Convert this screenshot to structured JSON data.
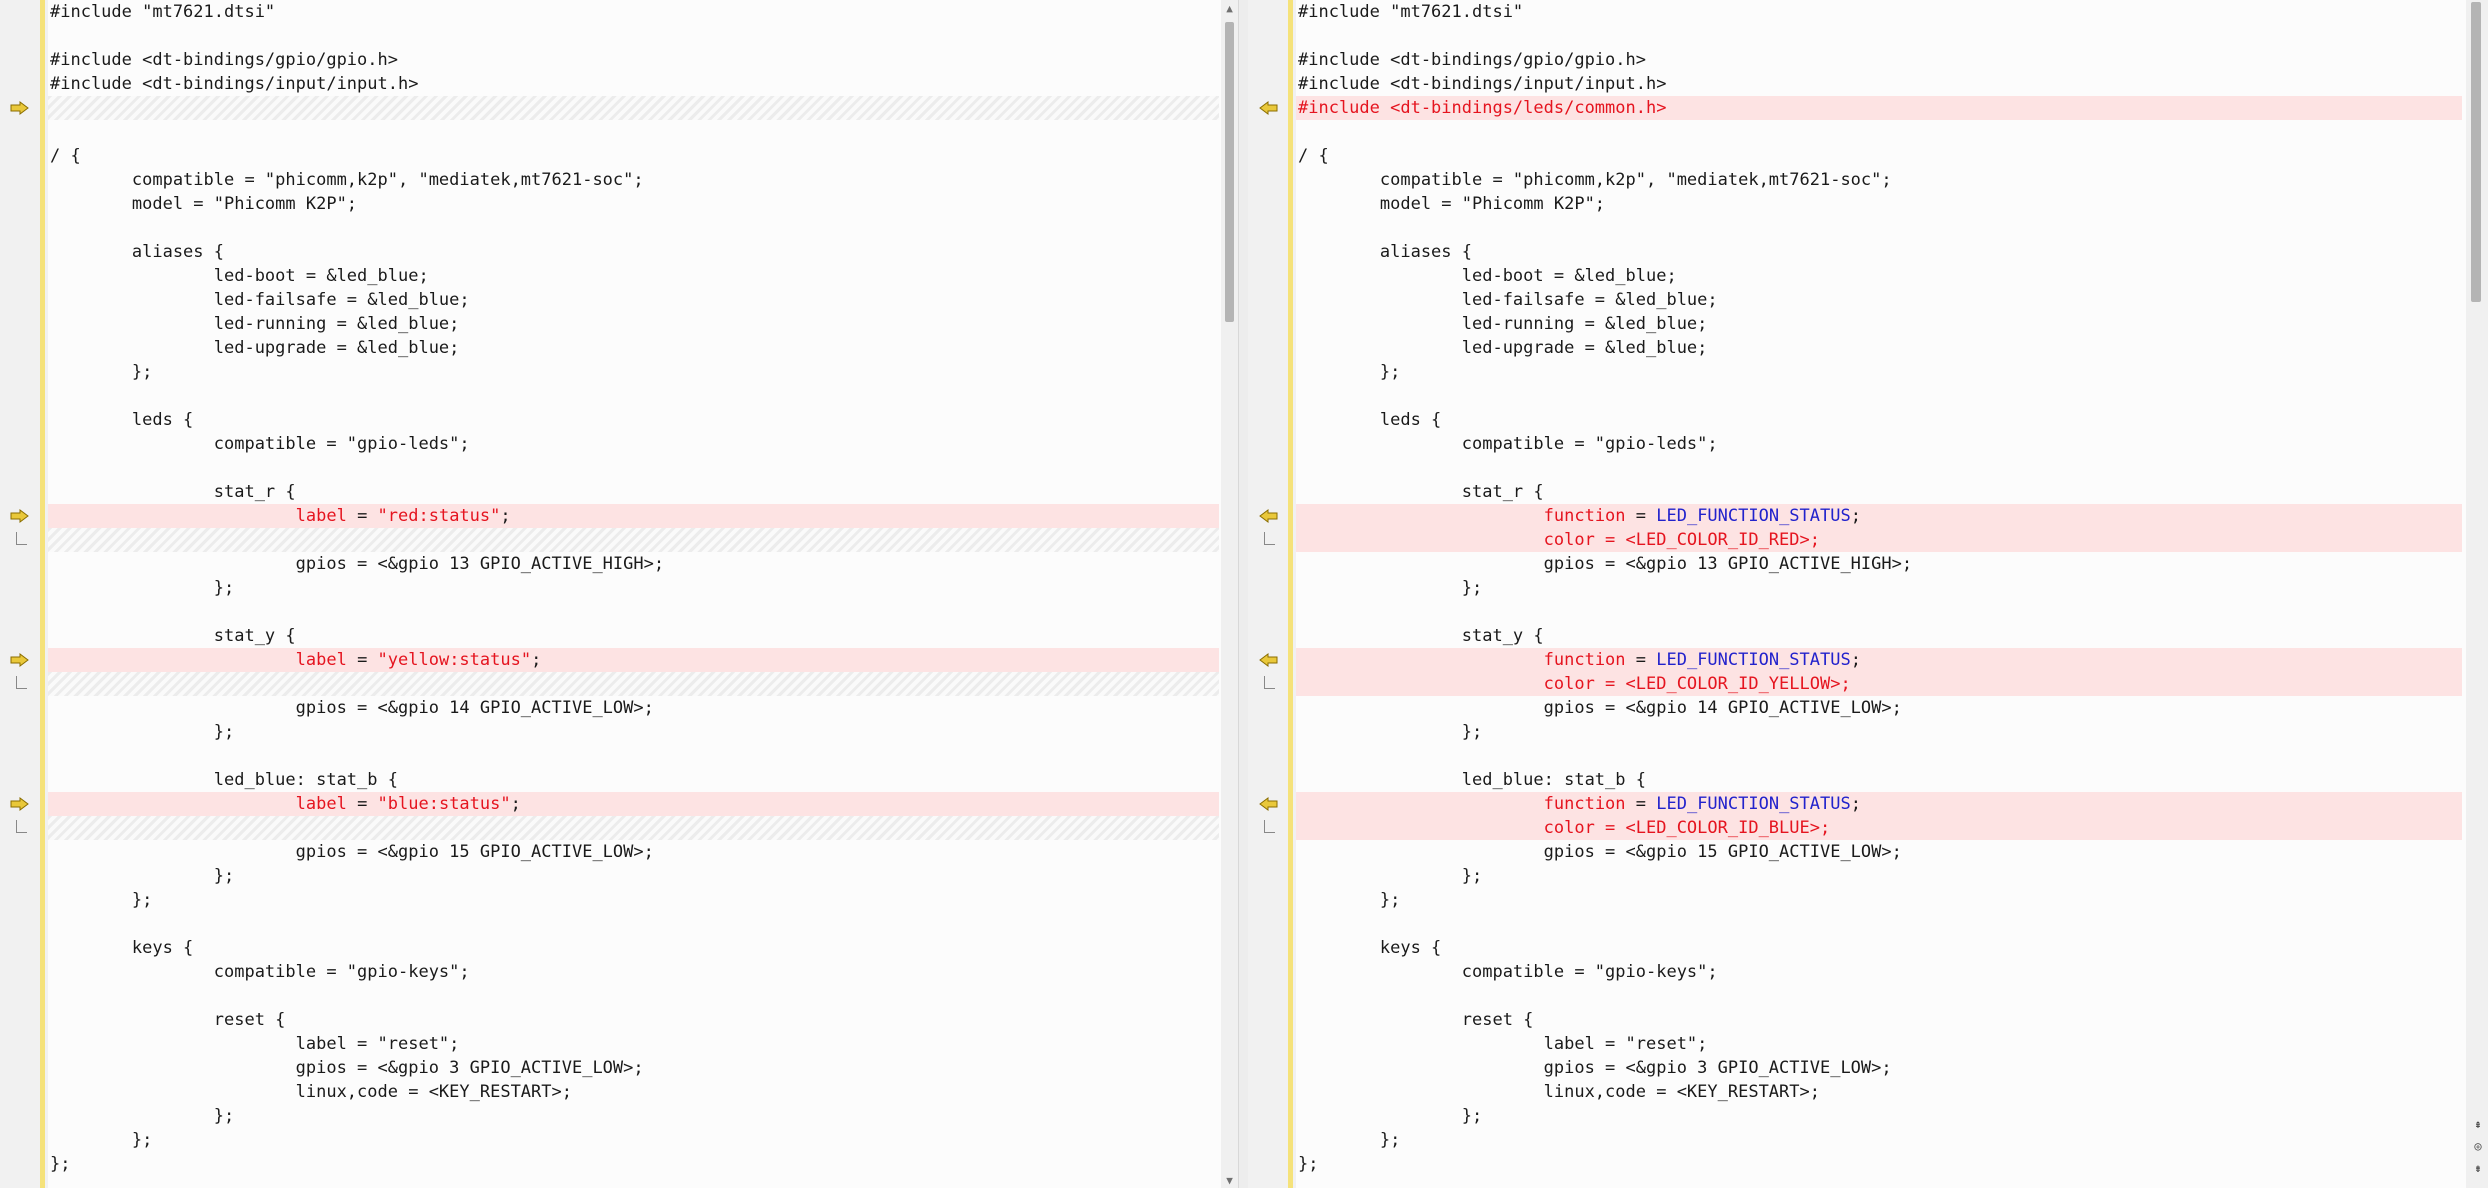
{
  "colors": {
    "diff_bg": "#fde3e3",
    "gutter_bar": "#f5e27a",
    "marker_arrow": "#e9c83a",
    "keyword_red": "#e5141f",
    "constant_blue": "#2222cc"
  },
  "icons": {
    "change_marker": "arrow-icon",
    "nav_up": "double-chevron-up-icon",
    "nav_center": "circle-icon",
    "nav_down": "double-chevron-down-icon"
  },
  "left": {
    "lines": [
      {
        "type": "normal",
        "segs": [
          {
            "t": "#include \"mt7621.dtsi\""
          }
        ]
      },
      {
        "type": "normal",
        "segs": [
          {
            "t": ""
          }
        ]
      },
      {
        "type": "normal",
        "segs": [
          {
            "t": "#include <dt-bindings/gpio/gpio.h>"
          }
        ]
      },
      {
        "type": "normal",
        "segs": [
          {
            "t": "#include <dt-bindings/input/input.h>"
          }
        ]
      },
      {
        "type": "placeholder",
        "marker": "arrow",
        "segs": [
          {
            "t": ""
          }
        ]
      },
      {
        "type": "normal",
        "segs": [
          {
            "t": ""
          }
        ]
      },
      {
        "type": "normal",
        "segs": [
          {
            "t": "/ {"
          }
        ]
      },
      {
        "type": "normal",
        "segs": [
          {
            "t": "\tcompatible = \"phicomm,k2p\", \"mediatek,mt7621-soc\";"
          }
        ]
      },
      {
        "type": "normal",
        "segs": [
          {
            "t": "\tmodel = \"Phicomm K2P\";"
          }
        ]
      },
      {
        "type": "normal",
        "segs": [
          {
            "t": ""
          }
        ]
      },
      {
        "type": "normal",
        "segs": [
          {
            "t": "\taliases {"
          }
        ]
      },
      {
        "type": "normal",
        "segs": [
          {
            "t": "\t\tled-boot = &led_blue;"
          }
        ]
      },
      {
        "type": "normal",
        "segs": [
          {
            "t": "\t\tled-failsafe = &led_blue;"
          }
        ]
      },
      {
        "type": "normal",
        "segs": [
          {
            "t": "\t\tled-running = &led_blue;"
          }
        ]
      },
      {
        "type": "normal",
        "segs": [
          {
            "t": "\t\tled-upgrade = &led_blue;"
          }
        ]
      },
      {
        "type": "normal",
        "segs": [
          {
            "t": "\t};"
          }
        ]
      },
      {
        "type": "normal",
        "segs": [
          {
            "t": ""
          }
        ]
      },
      {
        "type": "normal",
        "segs": [
          {
            "t": "\tleds {"
          }
        ]
      },
      {
        "type": "normal",
        "segs": [
          {
            "t": "\t\tcompatible = \"gpio-leds\";"
          }
        ]
      },
      {
        "type": "normal",
        "segs": [
          {
            "t": ""
          }
        ]
      },
      {
        "type": "normal",
        "segs": [
          {
            "t": "\t\tstat_r {"
          }
        ]
      },
      {
        "type": "changed",
        "marker": "arrow",
        "segs": [
          {
            "t": "\t\t\t"
          },
          {
            "t": "label",
            "c": "attr"
          },
          {
            "t": " = "
          },
          {
            "t": "\"red:status\"",
            "c": "str"
          },
          {
            "t": ";"
          }
        ]
      },
      {
        "type": "placeholder",
        "marker": "cont",
        "segs": [
          {
            "t": ""
          }
        ]
      },
      {
        "type": "normal",
        "segs": [
          {
            "t": "\t\t\tgpios = <&gpio 13 GPIO_ACTIVE_HIGH>;"
          }
        ]
      },
      {
        "type": "normal",
        "segs": [
          {
            "t": "\t\t};"
          }
        ]
      },
      {
        "type": "normal",
        "segs": [
          {
            "t": ""
          }
        ]
      },
      {
        "type": "normal",
        "segs": [
          {
            "t": "\t\tstat_y {"
          }
        ]
      },
      {
        "type": "changed",
        "marker": "arrow",
        "segs": [
          {
            "t": "\t\t\t"
          },
          {
            "t": "label",
            "c": "attr"
          },
          {
            "t": " = "
          },
          {
            "t": "\"yellow:status\"",
            "c": "str"
          },
          {
            "t": ";"
          }
        ]
      },
      {
        "type": "placeholder",
        "marker": "cont",
        "segs": [
          {
            "t": ""
          }
        ]
      },
      {
        "type": "normal",
        "segs": [
          {
            "t": "\t\t\tgpios = <&gpio 14 GPIO_ACTIVE_LOW>;"
          }
        ]
      },
      {
        "type": "normal",
        "segs": [
          {
            "t": "\t\t};"
          }
        ]
      },
      {
        "type": "normal",
        "segs": [
          {
            "t": ""
          }
        ]
      },
      {
        "type": "normal",
        "segs": [
          {
            "t": "\t\tled_blue: stat_b {"
          }
        ]
      },
      {
        "type": "changed",
        "marker": "arrow",
        "segs": [
          {
            "t": "\t\t\t"
          },
          {
            "t": "label",
            "c": "attr"
          },
          {
            "t": " = "
          },
          {
            "t": "\"blue:status\"",
            "c": "str"
          },
          {
            "t": ";"
          }
        ]
      },
      {
        "type": "placeholder",
        "marker": "cont",
        "segs": [
          {
            "t": ""
          }
        ]
      },
      {
        "type": "normal",
        "segs": [
          {
            "t": "\t\t\tgpios = <&gpio 15 GPIO_ACTIVE_LOW>;"
          }
        ]
      },
      {
        "type": "normal",
        "segs": [
          {
            "t": "\t\t};"
          }
        ]
      },
      {
        "type": "normal",
        "segs": [
          {
            "t": "\t};"
          }
        ]
      },
      {
        "type": "normal",
        "segs": [
          {
            "t": ""
          }
        ]
      },
      {
        "type": "normal",
        "segs": [
          {
            "t": "\tkeys {"
          }
        ]
      },
      {
        "type": "normal",
        "segs": [
          {
            "t": "\t\tcompatible = \"gpio-keys\";"
          }
        ]
      },
      {
        "type": "normal",
        "segs": [
          {
            "t": ""
          }
        ]
      },
      {
        "type": "normal",
        "segs": [
          {
            "t": "\t\treset {"
          }
        ]
      },
      {
        "type": "normal",
        "segs": [
          {
            "t": "\t\t\tlabel = \"reset\";"
          }
        ]
      },
      {
        "type": "normal",
        "segs": [
          {
            "t": "\t\t\tgpios = <&gpio 3 GPIO_ACTIVE_LOW>;"
          }
        ]
      },
      {
        "type": "normal",
        "segs": [
          {
            "t": "\t\t\tlinux,code = <KEY_RESTART>;"
          }
        ]
      },
      {
        "type": "normal",
        "segs": [
          {
            "t": "\t\t};"
          }
        ]
      },
      {
        "type": "normal",
        "segs": [
          {
            "t": "\t};"
          }
        ]
      },
      {
        "type": "normal",
        "segs": [
          {
            "t": "};"
          }
        ]
      }
    ]
  },
  "right": {
    "lines": [
      {
        "type": "normal",
        "segs": [
          {
            "t": "#include \"mt7621.dtsi\""
          }
        ]
      },
      {
        "type": "normal",
        "segs": [
          {
            "t": ""
          }
        ]
      },
      {
        "type": "normal",
        "segs": [
          {
            "t": "#include <dt-bindings/gpio/gpio.h>"
          }
        ]
      },
      {
        "type": "normal",
        "segs": [
          {
            "t": "#include <dt-bindings/input/input.h>"
          }
        ]
      },
      {
        "type": "changed",
        "red": true,
        "marker": "arrow",
        "segs": [
          {
            "t": "#include <dt-bindings/leds/common.h>"
          }
        ]
      },
      {
        "type": "normal",
        "segs": [
          {
            "t": ""
          }
        ]
      },
      {
        "type": "normal",
        "segs": [
          {
            "t": "/ {"
          }
        ]
      },
      {
        "type": "normal",
        "segs": [
          {
            "t": "\tcompatible = \"phicomm,k2p\", \"mediatek,mt7621-soc\";"
          }
        ]
      },
      {
        "type": "normal",
        "segs": [
          {
            "t": "\tmodel = \"Phicomm K2P\";"
          }
        ]
      },
      {
        "type": "normal",
        "segs": [
          {
            "t": ""
          }
        ]
      },
      {
        "type": "normal",
        "segs": [
          {
            "t": "\taliases {"
          }
        ]
      },
      {
        "type": "normal",
        "segs": [
          {
            "t": "\t\tled-boot = &led_blue;"
          }
        ]
      },
      {
        "type": "normal",
        "segs": [
          {
            "t": "\t\tled-failsafe = &led_blue;"
          }
        ]
      },
      {
        "type": "normal",
        "segs": [
          {
            "t": "\t\tled-running = &led_blue;"
          }
        ]
      },
      {
        "type": "normal",
        "segs": [
          {
            "t": "\t\tled-upgrade = &led_blue;"
          }
        ]
      },
      {
        "type": "normal",
        "segs": [
          {
            "t": "\t};"
          }
        ]
      },
      {
        "type": "normal",
        "segs": [
          {
            "t": ""
          }
        ]
      },
      {
        "type": "normal",
        "segs": [
          {
            "t": "\tleds {"
          }
        ]
      },
      {
        "type": "normal",
        "segs": [
          {
            "t": "\t\tcompatible = \"gpio-leds\";"
          }
        ]
      },
      {
        "type": "normal",
        "segs": [
          {
            "t": ""
          }
        ]
      },
      {
        "type": "normal",
        "segs": [
          {
            "t": "\t\tstat_r {"
          }
        ]
      },
      {
        "type": "changed",
        "marker": "arrow",
        "segs": [
          {
            "t": "\t\t\t"
          },
          {
            "t": "function",
            "c": "attr"
          },
          {
            "t": " = "
          },
          {
            "t": "LED_FUNCTION_STATUS",
            "c": "const"
          },
          {
            "t": ";"
          }
        ]
      },
      {
        "type": "changed",
        "marker": "cont",
        "segs": [
          {
            "t": "\t\t\t"
          },
          {
            "t": "color = <LED_COLOR_ID_RED>;",
            "c": "attr"
          }
        ]
      },
      {
        "type": "normal",
        "segs": [
          {
            "t": "\t\t\tgpios = <&gpio 13 GPIO_ACTIVE_HIGH>;"
          }
        ]
      },
      {
        "type": "normal",
        "segs": [
          {
            "t": "\t\t};"
          }
        ]
      },
      {
        "type": "normal",
        "segs": [
          {
            "t": ""
          }
        ]
      },
      {
        "type": "normal",
        "segs": [
          {
            "t": "\t\tstat_y {"
          }
        ]
      },
      {
        "type": "changed",
        "marker": "arrow",
        "segs": [
          {
            "t": "\t\t\t"
          },
          {
            "t": "function",
            "c": "attr"
          },
          {
            "t": " = "
          },
          {
            "t": "LED_FUNCTION_STATUS",
            "c": "const"
          },
          {
            "t": ";"
          }
        ]
      },
      {
        "type": "changed",
        "marker": "cont",
        "segs": [
          {
            "t": "\t\t\t"
          },
          {
            "t": "color = <LED_COLOR_ID_YELLOW>;",
            "c": "attr"
          }
        ]
      },
      {
        "type": "normal",
        "segs": [
          {
            "t": "\t\t\tgpios = <&gpio 14 GPIO_ACTIVE_LOW>;"
          }
        ]
      },
      {
        "type": "normal",
        "segs": [
          {
            "t": "\t\t};"
          }
        ]
      },
      {
        "type": "normal",
        "segs": [
          {
            "t": ""
          }
        ]
      },
      {
        "type": "normal",
        "segs": [
          {
            "t": "\t\tled_blue: stat_b {"
          }
        ]
      },
      {
        "type": "changed",
        "marker": "arrow",
        "segs": [
          {
            "t": "\t\t\t"
          },
          {
            "t": "function",
            "c": "attr"
          },
          {
            "t": " = "
          },
          {
            "t": "LED_FUNCTION_STATUS",
            "c": "const"
          },
          {
            "t": ";"
          }
        ]
      },
      {
        "type": "changed",
        "marker": "cont",
        "segs": [
          {
            "t": "\t\t\t"
          },
          {
            "t": "color = <LED_COLOR_ID_BLUE>;",
            "c": "attr"
          }
        ]
      },
      {
        "type": "normal",
        "segs": [
          {
            "t": "\t\t\tgpios = <&gpio 15 GPIO_ACTIVE_LOW>;"
          }
        ]
      },
      {
        "type": "normal",
        "segs": [
          {
            "t": "\t\t};"
          }
        ]
      },
      {
        "type": "normal",
        "segs": [
          {
            "t": "\t};"
          }
        ]
      },
      {
        "type": "normal",
        "segs": [
          {
            "t": ""
          }
        ]
      },
      {
        "type": "normal",
        "segs": [
          {
            "t": "\tkeys {"
          }
        ]
      },
      {
        "type": "normal",
        "segs": [
          {
            "t": "\t\tcompatible = \"gpio-keys\";"
          }
        ]
      },
      {
        "type": "normal",
        "segs": [
          {
            "t": ""
          }
        ]
      },
      {
        "type": "normal",
        "segs": [
          {
            "t": "\t\treset {"
          }
        ]
      },
      {
        "type": "normal",
        "segs": [
          {
            "t": "\t\t\tlabel = \"reset\";"
          }
        ]
      },
      {
        "type": "normal",
        "segs": [
          {
            "t": "\t\t\tgpios = <&gpio 3 GPIO_ACTIVE_LOW>;"
          }
        ]
      },
      {
        "type": "normal",
        "segs": [
          {
            "t": "\t\t\tlinux,code = <KEY_RESTART>;"
          }
        ]
      },
      {
        "type": "normal",
        "segs": [
          {
            "t": "\t\t};"
          }
        ]
      },
      {
        "type": "normal",
        "segs": [
          {
            "t": "\t};"
          }
        ]
      },
      {
        "type": "normal",
        "segs": [
          {
            "t": "};"
          }
        ]
      }
    ]
  }
}
